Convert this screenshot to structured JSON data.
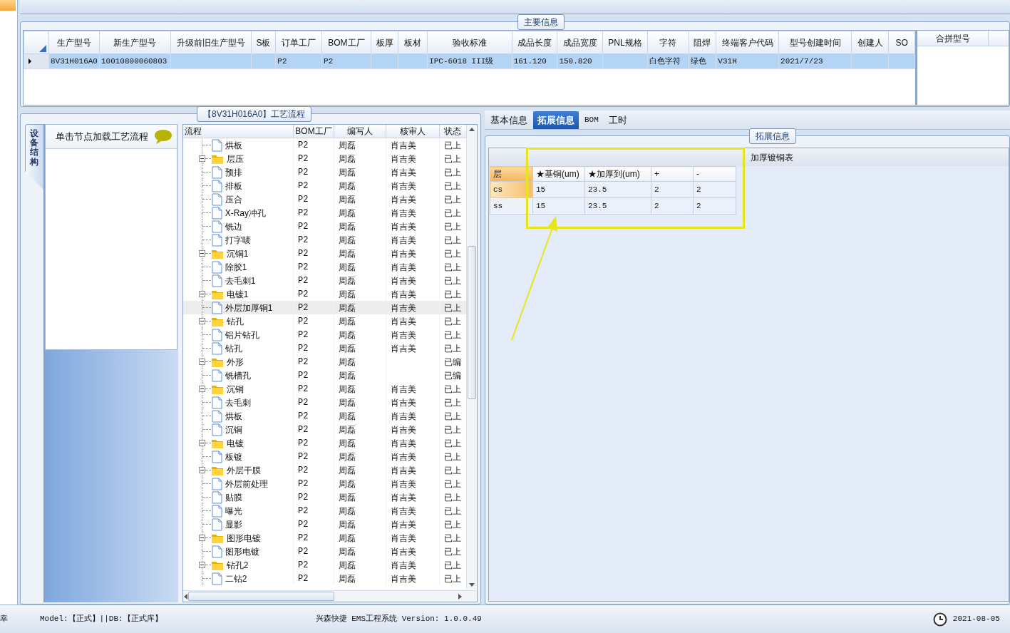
{
  "main_info": {
    "legend": "主要信息",
    "columns": [
      "生产型号",
      "新生产型号",
      "升级前旧生产型号",
      "S板",
      "订单工厂",
      "BOM工厂",
      "板厚",
      "板材",
      "验收标准",
      "成品长度",
      "成品宽度",
      "PNL规格",
      "字符",
      "阻焊",
      "终端客户代码",
      "型号创建时间",
      "创建人",
      "SO"
    ],
    "rows": [
      {
        "selected": true,
        "cells": [
          "8V31H016A0",
          "10010800060803",
          "",
          "",
          "P2",
          "P2",
          "",
          "",
          "IPC-6018 III级",
          "161.120",
          "150.820",
          "",
          "白色字符",
          "绿色",
          "V31H",
          "2021/7/23",
          "",
          ""
        ]
      }
    ],
    "side_columns": [
      "合拼型号"
    ]
  },
  "process": {
    "legend": "【8V31H016A0】工艺流程",
    "side_tab": "设备结构",
    "hint": "单击节点加载工艺流程",
    "columns": [
      "流程",
      "BOM工厂",
      "编写人",
      "核审人",
      "状态"
    ],
    "rows": [
      {
        "kind": "file",
        "label": "烘板",
        "bom": "P2",
        "author": "周磊",
        "reviewer": "肖吉美",
        "status": "已上",
        "selected": false
      },
      {
        "kind": "folder",
        "label": "层压",
        "bom": "P2",
        "author": "周磊",
        "reviewer": "肖吉美",
        "status": "已上",
        "selected": false,
        "children": [
          {
            "kind": "file",
            "label": "预排",
            "bom": "P2",
            "author": "周磊",
            "reviewer": "肖吉美",
            "status": "已上",
            "selected": false
          },
          {
            "kind": "file",
            "label": "排板",
            "bom": "P2",
            "author": "周磊",
            "reviewer": "肖吉美",
            "status": "已上",
            "selected": false
          },
          {
            "kind": "file",
            "label": "压合",
            "bom": "P2",
            "author": "周磊",
            "reviewer": "肖吉美",
            "status": "已上",
            "selected": false
          },
          {
            "kind": "file",
            "label": "X-Ray冲孔",
            "bom": "P2",
            "author": "周磊",
            "reviewer": "肖吉美",
            "status": "已上",
            "selected": false
          },
          {
            "kind": "file",
            "label": "铣边",
            "bom": "P2",
            "author": "周磊",
            "reviewer": "肖吉美",
            "status": "已上",
            "selected": false
          },
          {
            "kind": "file",
            "label": "打字唛",
            "bom": "P2",
            "author": "周磊",
            "reviewer": "肖吉美",
            "status": "已上",
            "selected": false
          }
        ]
      },
      {
        "kind": "folder",
        "label": "沉铜1",
        "bom": "P2",
        "author": "周磊",
        "reviewer": "肖吉美",
        "status": "已上",
        "selected": false,
        "children": [
          {
            "kind": "file",
            "label": "除胶1",
            "bom": "P2",
            "author": "周磊",
            "reviewer": "肖吉美",
            "status": "已上",
            "selected": false
          },
          {
            "kind": "file",
            "label": "去毛刺1",
            "bom": "P2",
            "author": "周磊",
            "reviewer": "肖吉美",
            "status": "已上",
            "selected": false
          }
        ]
      },
      {
        "kind": "folder",
        "label": "电镀1",
        "bom": "P2",
        "author": "周磊",
        "reviewer": "肖吉美",
        "status": "已上",
        "selected": false,
        "children": [
          {
            "kind": "file",
            "label": "外层加厚铜1",
            "bom": "P2",
            "author": "周磊",
            "reviewer": "肖吉美",
            "status": "已上",
            "selected": true
          }
        ]
      },
      {
        "kind": "folder",
        "label": "钻孔",
        "bom": "P2",
        "author": "周磊",
        "reviewer": "肖吉美",
        "status": "已上",
        "selected": false,
        "children": [
          {
            "kind": "file",
            "label": "铝片钻孔",
            "bom": "P2",
            "author": "周磊",
            "reviewer": "肖吉美",
            "status": "已上",
            "selected": false
          },
          {
            "kind": "file",
            "label": "钻孔",
            "bom": "P2",
            "author": "周磊",
            "reviewer": "肖吉美",
            "status": "已上",
            "selected": false
          }
        ]
      },
      {
        "kind": "folder",
        "label": "外形",
        "bom": "P2",
        "author": "周磊",
        "status": "已编",
        "selected": false,
        "children": [
          {
            "kind": "file",
            "label": "铣槽孔",
            "bom": "P2",
            "author": "周磊",
            "status": "已编",
            "selected": false
          }
        ]
      },
      {
        "kind": "folder",
        "label": "沉铜",
        "bom": "P2",
        "author": "周磊",
        "reviewer": "肖吉美",
        "status": "已上",
        "selected": false,
        "children": [
          {
            "kind": "file",
            "label": "去毛刺",
            "bom": "P2",
            "author": "周磊",
            "reviewer": "肖吉美",
            "status": "已上",
            "selected": false
          },
          {
            "kind": "file",
            "label": "烘板",
            "bom": "P2",
            "author": "周磊",
            "reviewer": "肖吉美",
            "status": "已上",
            "selected": false
          },
          {
            "kind": "file",
            "label": "沉铜",
            "bom": "P2",
            "author": "周磊",
            "reviewer": "肖吉美",
            "status": "已上",
            "selected": false
          }
        ]
      },
      {
        "kind": "folder",
        "label": "电镀",
        "bom": "P2",
        "author": "周磊",
        "reviewer": "肖吉美",
        "status": "已上",
        "selected": false,
        "children": [
          {
            "kind": "file",
            "label": "板镀",
            "bom": "P2",
            "author": "周磊",
            "reviewer": "肖吉美",
            "status": "已上",
            "selected": false
          }
        ]
      },
      {
        "kind": "folder",
        "label": "外层干膜",
        "bom": "P2",
        "author": "周磊",
        "reviewer": "肖吉美",
        "status": "已上",
        "selected": false,
        "children": [
          {
            "kind": "file",
            "label": "外层前处理",
            "bom": "P2",
            "author": "周磊",
            "reviewer": "肖吉美",
            "status": "已上",
            "selected": false
          },
          {
            "kind": "file",
            "label": "贴膜",
            "bom": "P2",
            "author": "周磊",
            "reviewer": "肖吉美",
            "status": "已上",
            "selected": false
          },
          {
            "kind": "file",
            "label": "曝光",
            "bom": "P2",
            "author": "周磊",
            "reviewer": "肖吉美",
            "status": "已上",
            "selected": false
          },
          {
            "kind": "file",
            "label": "显影",
            "bom": "P2",
            "author": "周磊",
            "reviewer": "肖吉美",
            "status": "已上",
            "selected": false
          }
        ]
      },
      {
        "kind": "folder",
        "label": "图形电镀",
        "bom": "P2",
        "author": "周磊",
        "reviewer": "肖吉美",
        "status": "已上",
        "selected": false,
        "children": [
          {
            "kind": "file",
            "label": "图形电镀",
            "bom": "P2",
            "author": "周磊",
            "reviewer": "肖吉美",
            "status": "已上",
            "selected": false
          }
        ]
      },
      {
        "kind": "folder",
        "label": "钻孔2",
        "bom": "P2",
        "author": "周磊",
        "reviewer": "肖吉美",
        "status": "已上",
        "selected": false,
        "children": [
          {
            "kind": "file",
            "label": "二钻2",
            "bom": "P2",
            "author": "周磊",
            "reviewer": "肖吉美",
            "status": "已上",
            "selected": false
          }
        ]
      }
    ]
  },
  "detail": {
    "tabs": [
      {
        "label": "基本信息",
        "selected": false
      },
      {
        "label": "拓展信息",
        "selected": true
      },
      {
        "label": "BOM",
        "selected": false
      },
      {
        "label": "工时",
        "selected": false
      }
    ],
    "legend": "拓展信息",
    "table_title": "加厚镀铜表",
    "columns": [
      "层",
      "★基铜(um)",
      "★加厚到(um)",
      "+",
      "-"
    ],
    "rows": [
      {
        "selected": true,
        "cells": [
          "cs",
          "15",
          "23.5",
          "2",
          "2"
        ]
      },
      {
        "selected": false,
        "cells": [
          "ss",
          "15",
          "23.5",
          "2",
          "2"
        ]
      }
    ]
  },
  "status_bar": {
    "fragment": "幸",
    "mode": "Model:【正式】||DB:【正式库】",
    "app": "兴森快捷 EMS工程系统 Version: 1.0.0.49",
    "date": "2021-08-05"
  }
}
